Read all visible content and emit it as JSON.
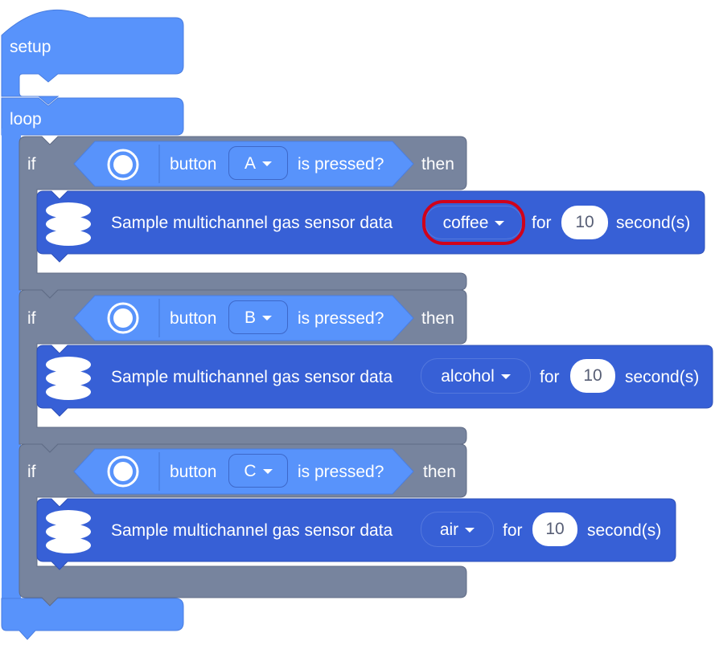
{
  "colors": {
    "event_blue": "#5893fb",
    "event_blue_dark": "#4a7ee0",
    "control_gray": "#77849e",
    "control_gray_dark": "#5f6b85",
    "sensor_blue": "#3760d6",
    "sensor_blue_dark": "#2e50b8",
    "highlight_red": "#d0021b"
  },
  "hats": {
    "setup_label": "setup",
    "loop_label": "loop"
  },
  "if_blocks": [
    {
      "if_label": "if",
      "condition": {
        "prefix": "button",
        "button_value": "A",
        "suffix": "is pressed?"
      },
      "then_label": "then",
      "action": {
        "text": "Sample multichannel gas sensor data",
        "gas_value": "coffee",
        "for_label": "for",
        "duration": "10",
        "unit_label": "second(s)",
        "highlighted": true
      }
    },
    {
      "if_label": "if",
      "condition": {
        "prefix": "button",
        "button_value": "B",
        "suffix": "is pressed?"
      },
      "then_label": "then",
      "action": {
        "text": "Sample multichannel gas sensor data",
        "gas_value": "alcohol",
        "for_label": "for",
        "duration": "10",
        "unit_label": "second(s)",
        "highlighted": false
      }
    },
    {
      "if_label": "if",
      "condition": {
        "prefix": "button",
        "button_value": "C",
        "suffix": "is pressed?"
      },
      "then_label": "then",
      "action": {
        "text": "Sample multichannel gas sensor data",
        "gas_value": "air",
        "for_label": "for",
        "duration": "10",
        "unit_label": "second(s)",
        "highlighted": false
      }
    }
  ]
}
